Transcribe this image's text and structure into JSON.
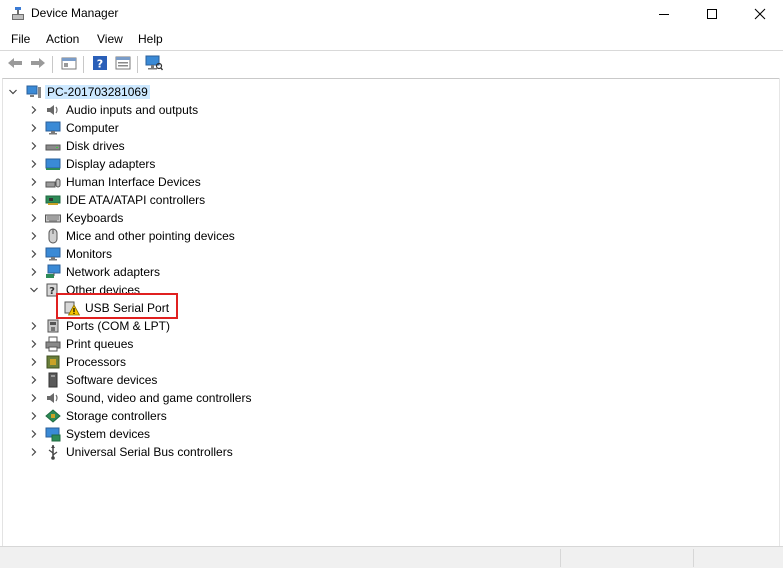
{
  "window": {
    "title": "Device Manager"
  },
  "menu": {
    "items": [
      "File",
      "Action",
      "View",
      "Help"
    ]
  },
  "toolbar": {
    "buttons": [
      "back-icon",
      "forward-icon",
      "show-hide-console-tree-icon",
      "help-icon",
      "properties-icon",
      "scan-hardware-changes-icon"
    ]
  },
  "tree": {
    "root": "PC-201703281069",
    "categories": [
      {
        "label": "Audio inputs and outputs",
        "icon": "speaker-icon"
      },
      {
        "label": "Computer",
        "icon": "computer-icon"
      },
      {
        "label": "Disk drives",
        "icon": "disk-drive-icon"
      },
      {
        "label": "Display adapters",
        "icon": "display-adapter-icon"
      },
      {
        "label": "Human Interface Devices",
        "icon": "hid-icon"
      },
      {
        "label": "IDE ATA/ATAPI controllers",
        "icon": "ide-controller-icon"
      },
      {
        "label": "Keyboards",
        "icon": "keyboard-icon"
      },
      {
        "label": "Mice and other pointing devices",
        "icon": "mouse-icon"
      },
      {
        "label": "Monitors",
        "icon": "monitor-icon"
      },
      {
        "label": "Network adapters",
        "icon": "network-adapter-icon"
      },
      {
        "label": "Other devices",
        "icon": "other-devices-icon",
        "expanded": true,
        "children": [
          {
            "label": "USB Serial Port",
            "icon": "warning-device-icon"
          }
        ]
      },
      {
        "label": "Ports (COM & LPT)",
        "icon": "port-icon"
      },
      {
        "label": "Print queues",
        "icon": "printer-icon"
      },
      {
        "label": "Processors",
        "icon": "processor-icon"
      },
      {
        "label": "Software devices",
        "icon": "software-device-icon"
      },
      {
        "label": "Sound, video and game controllers",
        "icon": "sound-controller-icon"
      },
      {
        "label": "Storage controllers",
        "icon": "storage-controller-icon"
      },
      {
        "label": "System devices",
        "icon": "system-device-icon"
      },
      {
        "label": "Universal Serial Bus controllers",
        "icon": "usb-icon"
      }
    ]
  },
  "colors": {
    "selection": "#cce8ff",
    "highlight_box": "#e02020",
    "accent_border": "#82c49b"
  }
}
